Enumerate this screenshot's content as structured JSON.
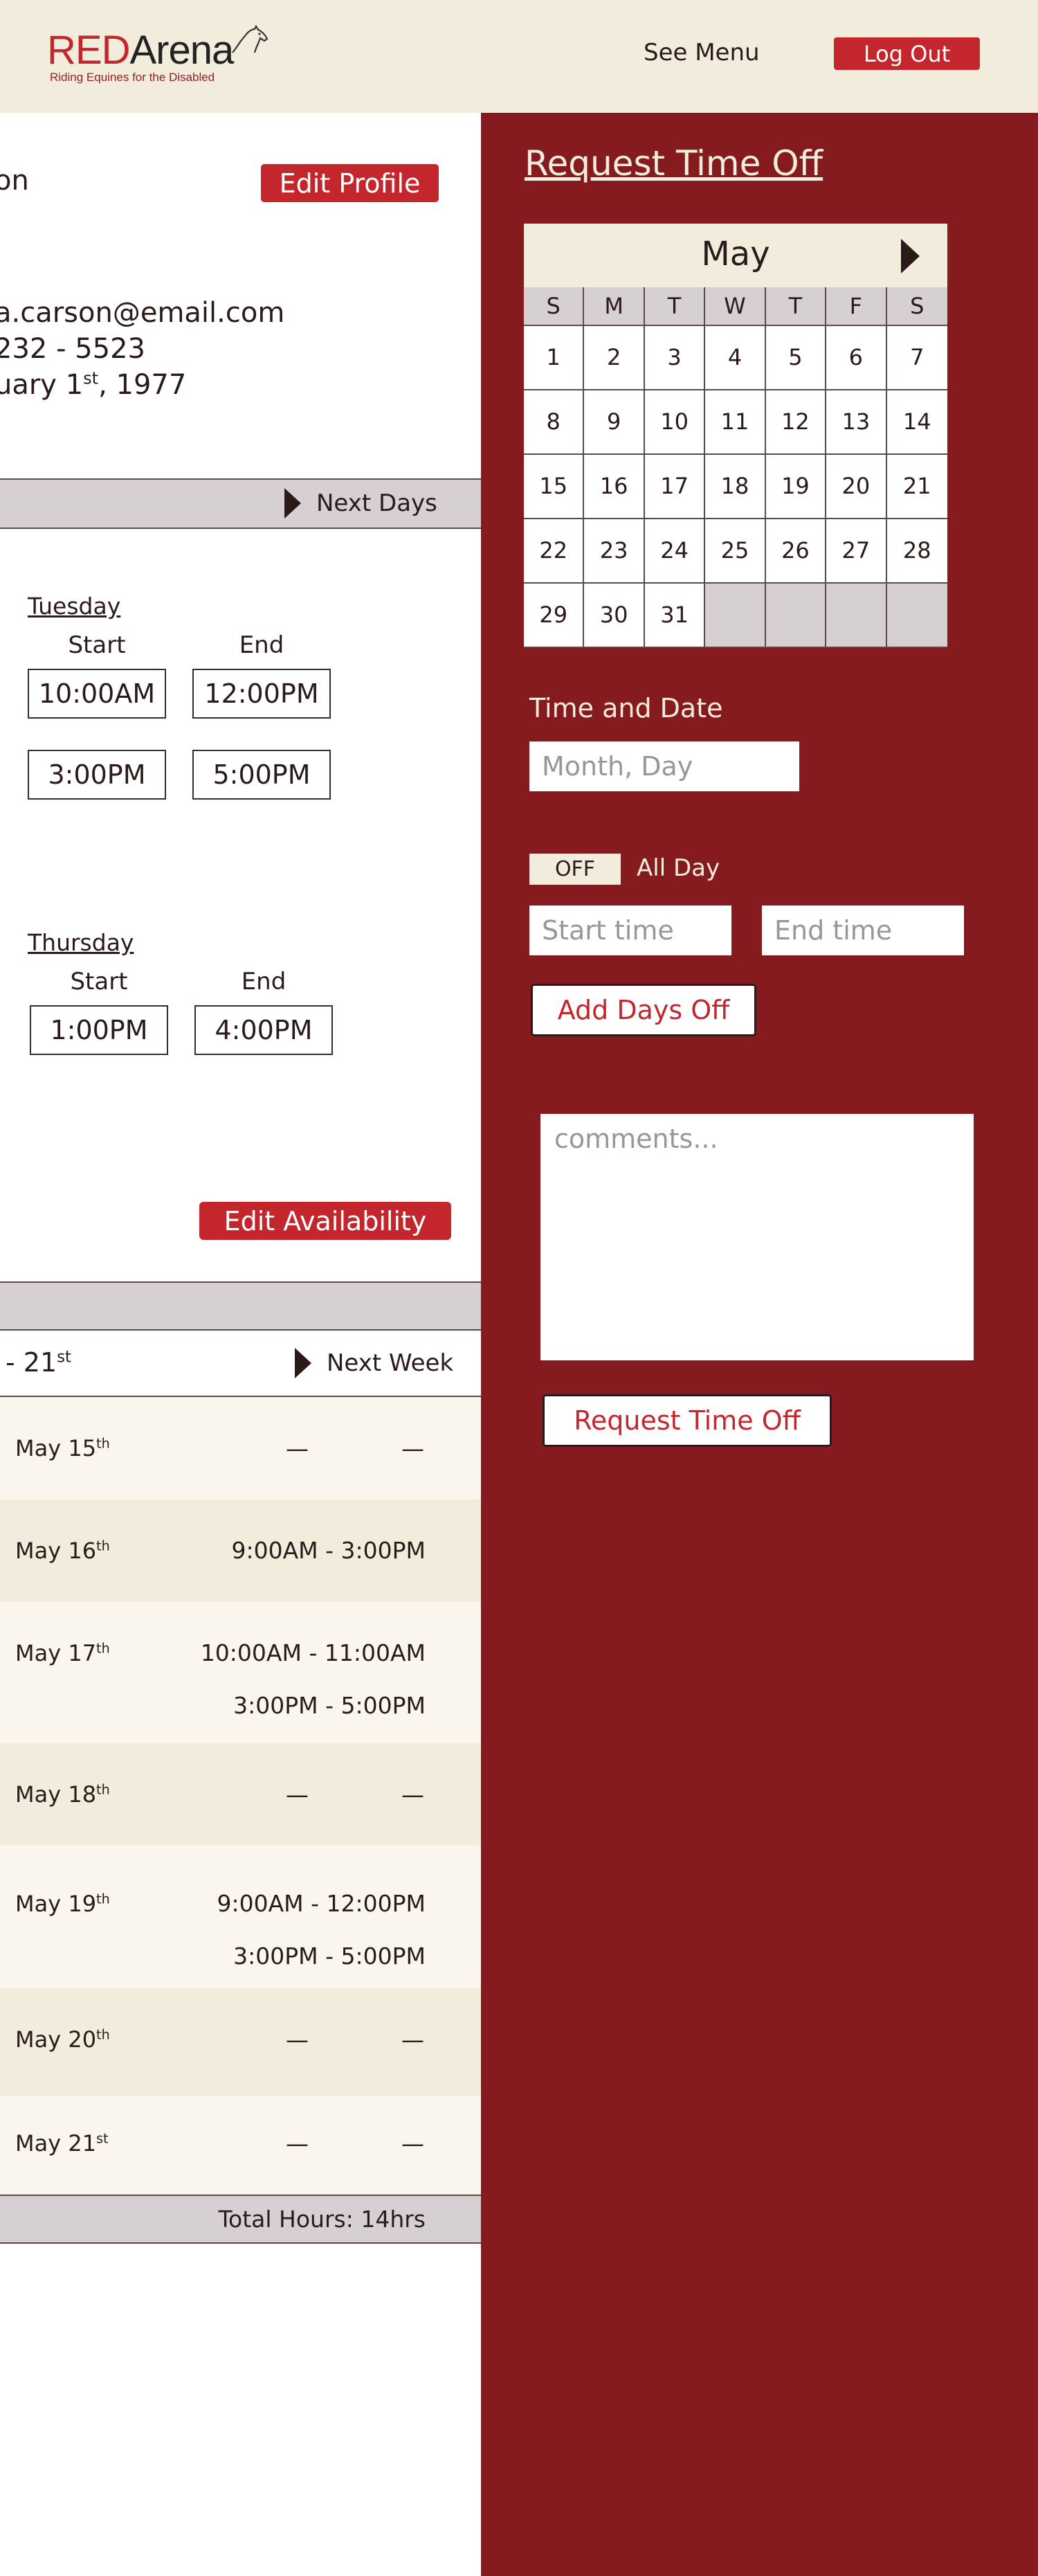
{
  "header": {
    "logo_red": "RED",
    "logo_arena": "Arena",
    "logo_tagline": "Riding Equines for the Disabled",
    "see_menu": "See Menu",
    "logout": "Log Out"
  },
  "profile": {
    "name_fragment": "on",
    "edit_button": "Edit Profile",
    "email_fragment": "a.carson@email.com",
    "phone_fragment": "232 - 5523",
    "birthday_fragment_pre": "uary 1",
    "birthday_fragment_sup": "st",
    "birthday_fragment_post": ", 1977"
  },
  "availability": {
    "next_label": "Next Days",
    "days": [
      {
        "name": "Tuesday",
        "start_header": "Start",
        "end_header": "End",
        "slots": [
          {
            "start": "10:00AM",
            "end": "12:00PM"
          },
          {
            "start": "3:00PM",
            "end": "5:00PM"
          }
        ]
      },
      {
        "name": "Thursday",
        "start_header": "Start",
        "end_header": "End",
        "slots": [
          {
            "start": "1:00PM",
            "end": "4:00PM"
          }
        ]
      }
    ],
    "edit_button": "Edit Availability"
  },
  "schedule": {
    "range_fragment": "- 21",
    "range_fragment_sup": "st",
    "next_label": "Next Week",
    "rows": [
      {
        "day": "May 15",
        "sup": "th",
        "times": []
      },
      {
        "day": "May 16",
        "sup": "th",
        "times": [
          "9:00AM - 3:00PM"
        ]
      },
      {
        "day": "May 17",
        "sup": "th",
        "times": [
          "10:00AM - 11:00AM",
          "3:00PM - 5:00PM"
        ]
      },
      {
        "day": "May 18",
        "sup": "th",
        "times": []
      },
      {
        "day": "May 19",
        "sup": "th",
        "times": [
          "9:00AM - 12:00PM",
          "3:00PM - 5:00PM"
        ]
      },
      {
        "day": "May 20",
        "sup": "th",
        "times": []
      },
      {
        "day": "May 21",
        "sup": "st",
        "times": []
      }
    ],
    "dash": "—",
    "total": "Total Hours: 14hrs"
  },
  "request": {
    "title": "Request Time Off",
    "calendar": {
      "month": "May",
      "weekdays": [
        "S",
        "M",
        "T",
        "W",
        "T",
        "F",
        "S"
      ],
      "days": [
        "1",
        "2",
        "3",
        "4",
        "5",
        "6",
        "7",
        "8",
        "9",
        "10",
        "11",
        "12",
        "13",
        "14",
        "15",
        "16",
        "17",
        "18",
        "19",
        "20",
        "21",
        "22",
        "23",
        "24",
        "25",
        "26",
        "27",
        "28",
        "29",
        "30",
        "31",
        "",
        "",
        "",
        ""
      ]
    },
    "time_date_label": "Time and Date",
    "date_placeholder": "Month, Day",
    "allday_toggle": "OFF",
    "allday_label": "All Day",
    "start_placeholder": "Start time",
    "end_placeholder": "End time",
    "add_days_button": "Add Days Off",
    "comments_placeholder": "comments...",
    "submit_button": "Request Time Off"
  },
  "colors": {
    "brand_red": "#c3262c",
    "panel_maroon": "#861b1f",
    "cream": "#f2ecdc",
    "grey_bar": "#d6d0d2"
  }
}
